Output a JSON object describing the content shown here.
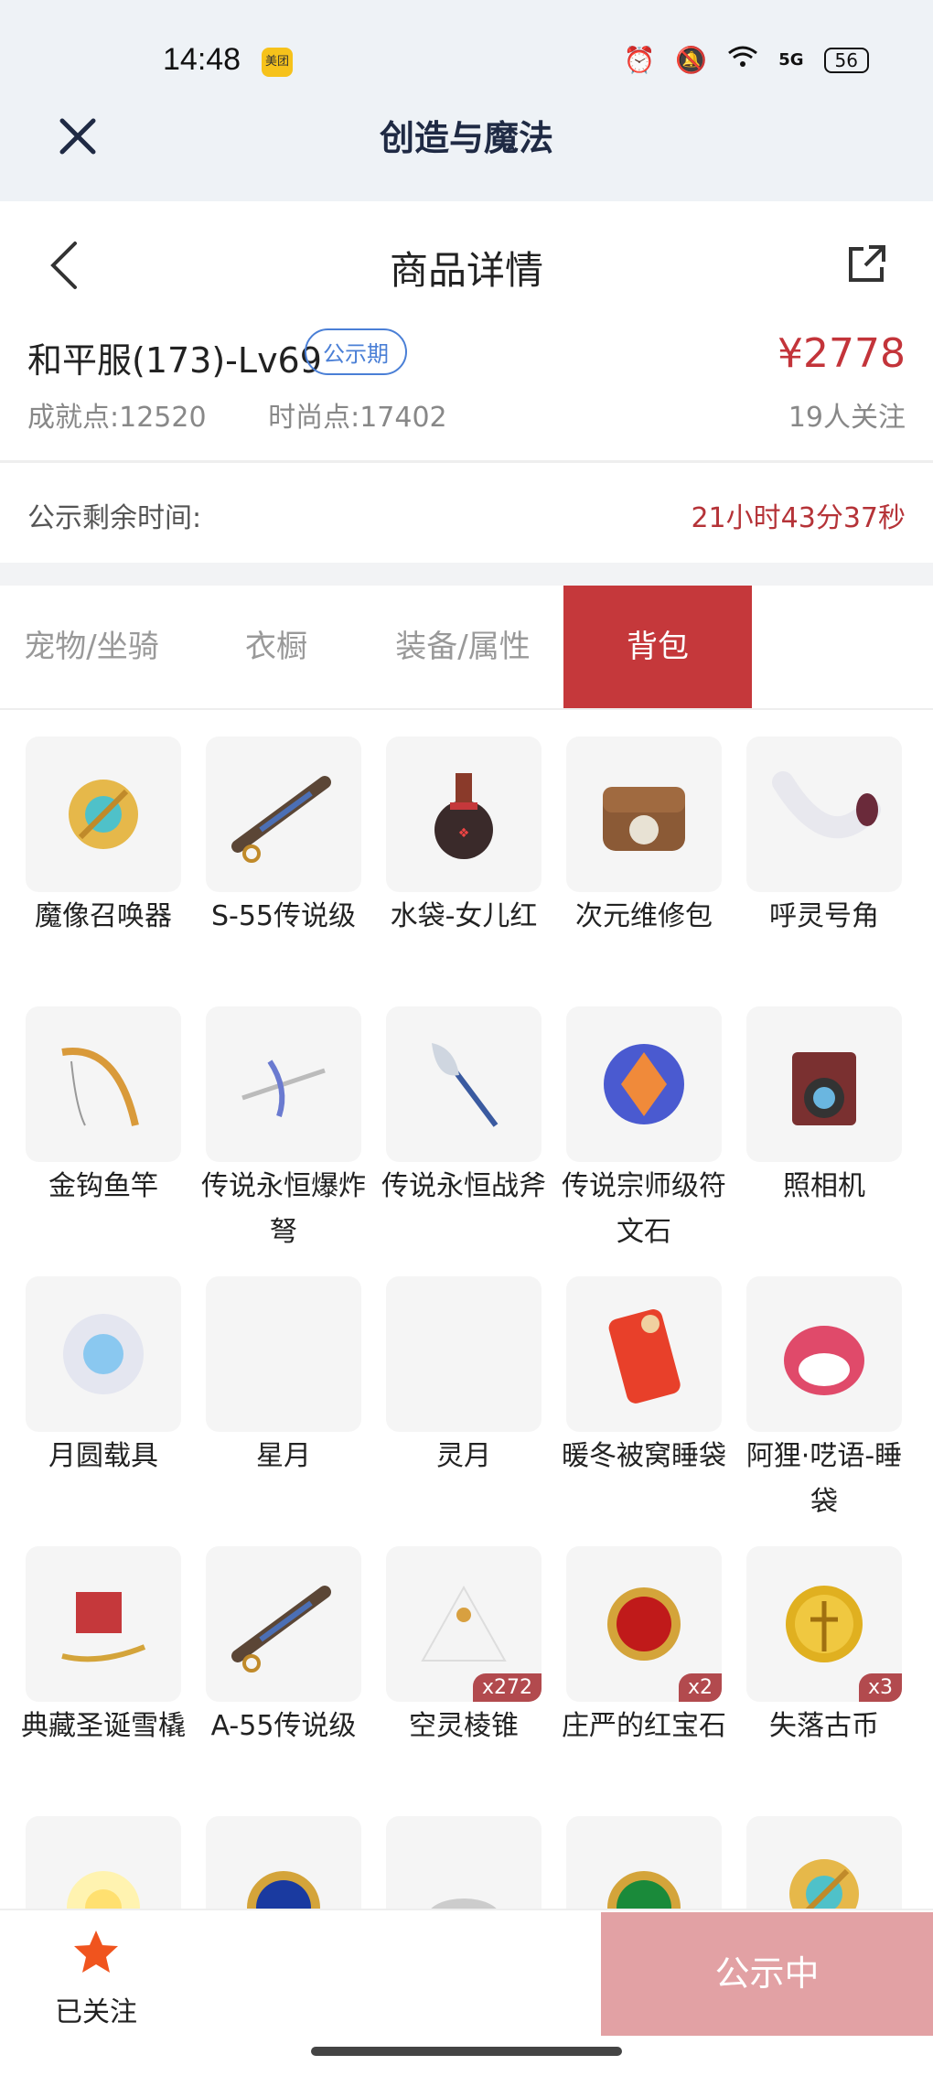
{
  "status_bar": {
    "time": "14:48",
    "app_badge": "美团",
    "battery": "56",
    "network": "5G"
  },
  "header": {
    "title": "创造与魔法"
  },
  "nav": {
    "title": "商品详情"
  },
  "product": {
    "name": "和平服(173)-Lv69",
    "badge": "公示期",
    "price": "¥2778",
    "achievement": "成就点:12520",
    "fashion": "时尚点:17402",
    "followers": "19人关注"
  },
  "remaining": {
    "label": "公示剩余时间:",
    "value": "21小时43分37秒"
  },
  "tabs": [
    {
      "label": "宠物/坐骑"
    },
    {
      "label": "衣橱"
    },
    {
      "label": "装备/属性"
    },
    {
      "label": "背包",
      "active": true
    }
  ],
  "items": [
    {
      "name": "魔像召唤器",
      "icon": "gold-gear-icon"
    },
    {
      "name": "S-55传说级",
      "icon": "rifle-icon"
    },
    {
      "name": "水袋-女儿红",
      "icon": "gourd-bottle-icon"
    },
    {
      "name": "次元维修包",
      "icon": "repair-bag-icon"
    },
    {
      "name": "呼灵号角",
      "icon": "horn-icon"
    },
    {
      "name": "金钩鱼竿",
      "icon": "fishing-rod-icon"
    },
    {
      "name": "传说永恒爆炸弩",
      "icon": "crossbow-icon"
    },
    {
      "name": "传说永恒战斧",
      "icon": "battle-axe-icon"
    },
    {
      "name": "传说宗师级符文石",
      "icon": "rune-stone-icon"
    },
    {
      "name": "照相机",
      "icon": "camera-icon"
    },
    {
      "name": "月圆载具",
      "icon": "moon-orb-icon"
    },
    {
      "name": "星月",
      "icon": "gold-crescent-icon"
    },
    {
      "name": "灵月",
      "icon": "blue-crescent-icon"
    },
    {
      "name": "暖冬被窝睡袋",
      "icon": "sleeping-bag-icon"
    },
    {
      "name": "阿狸·呓语-睡袋",
      "icon": "fox-sleeping-bag-icon"
    },
    {
      "name": "典藏圣诞雪橇",
      "icon": "sleigh-icon"
    },
    {
      "name": "A-55传说级",
      "icon": "rifle-icon"
    },
    {
      "name": "空灵棱锥",
      "icon": "pyramid-icon",
      "qty": "x272"
    },
    {
      "name": "庄严的红宝石",
      "icon": "red-gem-icon",
      "qty": "x2"
    },
    {
      "name": "失落古币",
      "icon": "gold-coin-icon",
      "qty": "x3"
    },
    {
      "name": "",
      "icon": "glow-icon"
    },
    {
      "name": "",
      "icon": "blue-gem-icon"
    },
    {
      "name": "",
      "icon": "gray-item-icon"
    },
    {
      "name": "",
      "icon": "green-gem-icon"
    },
    {
      "name": "",
      "icon": "gold-gear-icon"
    }
  ],
  "bottom": {
    "follow_label": "已关注",
    "action_label": "公示中"
  },
  "colors": {
    "accent": "#c5383b",
    "price": "#c3343a",
    "badge": "#4a7fd6",
    "action_disabled": "#e2a1a4"
  }
}
